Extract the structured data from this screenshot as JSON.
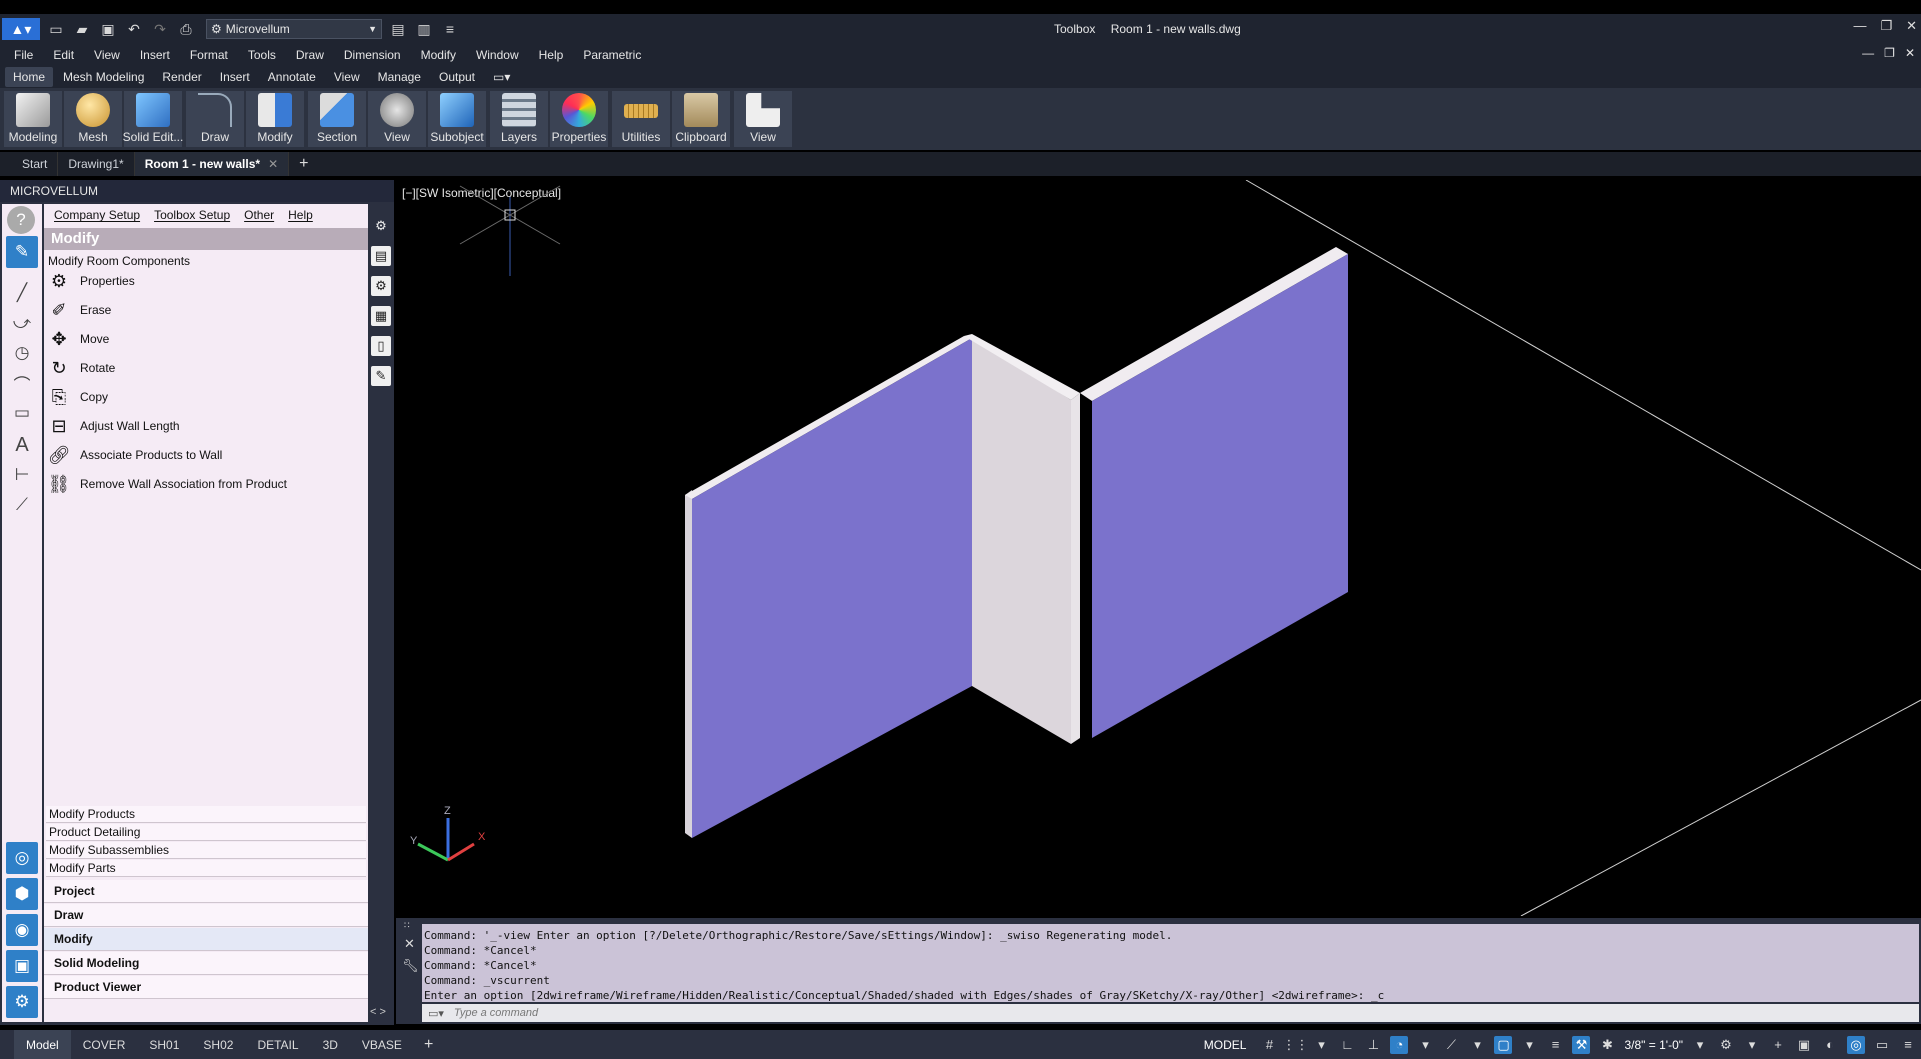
{
  "titlebar": {
    "workspace": "Microvellum",
    "app_name": "Toolbox",
    "document_name": "Room 1 - new walls.dwg"
  },
  "menubar": [
    "File",
    "Edit",
    "View",
    "Insert",
    "Format",
    "Tools",
    "Draw",
    "Dimension",
    "Modify",
    "Window",
    "Help",
    "Parametric"
  ],
  "ribbon_tabs": [
    "Home",
    "Mesh Modeling",
    "Render",
    "Insert",
    "Annotate",
    "View",
    "Manage",
    "Output"
  ],
  "ribbon_panels": [
    "Modeling",
    "Mesh",
    "Solid Edit...",
    "Draw",
    "Modify",
    "Section",
    "View",
    "Subobject",
    "Layers",
    "Properties",
    "Utilities",
    "Clipboard",
    "View"
  ],
  "doc_tabs": [
    "Start",
    "Drawing1*",
    "Room 1 - new walls*"
  ],
  "palette": {
    "title": "MICROVELLUM",
    "menu": [
      "Company Setup",
      "Toolbox Setup",
      "Other",
      "Help"
    ],
    "section_title": "Modify",
    "section_subtitle": "Modify Room Components",
    "commands": [
      "Properties",
      "Erase",
      "Move",
      "Rotate",
      "Copy",
      "Adjust Wall Length",
      "Associate Products to Wall",
      "Remove Wall Association from Product"
    ],
    "sub_sections": [
      "Modify Products",
      "Product Detailing",
      "Modify Subassemblies",
      "Modify Parts"
    ],
    "categories": [
      "Project",
      "Draw",
      "Modify",
      "Solid Modeling",
      "Product Viewer"
    ],
    "nav": "< >"
  },
  "viewport": {
    "label": "[−][SW Isometric][Conceptual]",
    "ucs_x": "X",
    "ucs_y": "Y",
    "ucs_z": "Z"
  },
  "command_history": [
    "Command: '_-view Enter an option [?/Delete/Orthographic/Restore/Save/sEttings/Window]: _swiso Regenerating model.",
    "Command: *Cancel*",
    "Command: *Cancel*",
    "Command: _vscurrent",
    "Enter an option [2dwireframe/Wireframe/Hidden/Realistic/Conceptual/Shaded/shaded with Edges/shades of Gray/SKetchy/X-ray/Other] <2dwireframe>: _c"
  ],
  "command_input_placeholder": "Type a command",
  "layout_tabs": [
    "Model",
    "COVER",
    "SH01",
    "SH02",
    "DETAIL",
    "3D",
    "VBASE"
  ],
  "status": {
    "mode": "MODEL",
    "scale": "3/8\" = 1'-0\""
  },
  "colors": {
    "wall_face": "#7b72cc",
    "wall_edge": "#dcd6dc",
    "accent": "#2f80c8"
  }
}
